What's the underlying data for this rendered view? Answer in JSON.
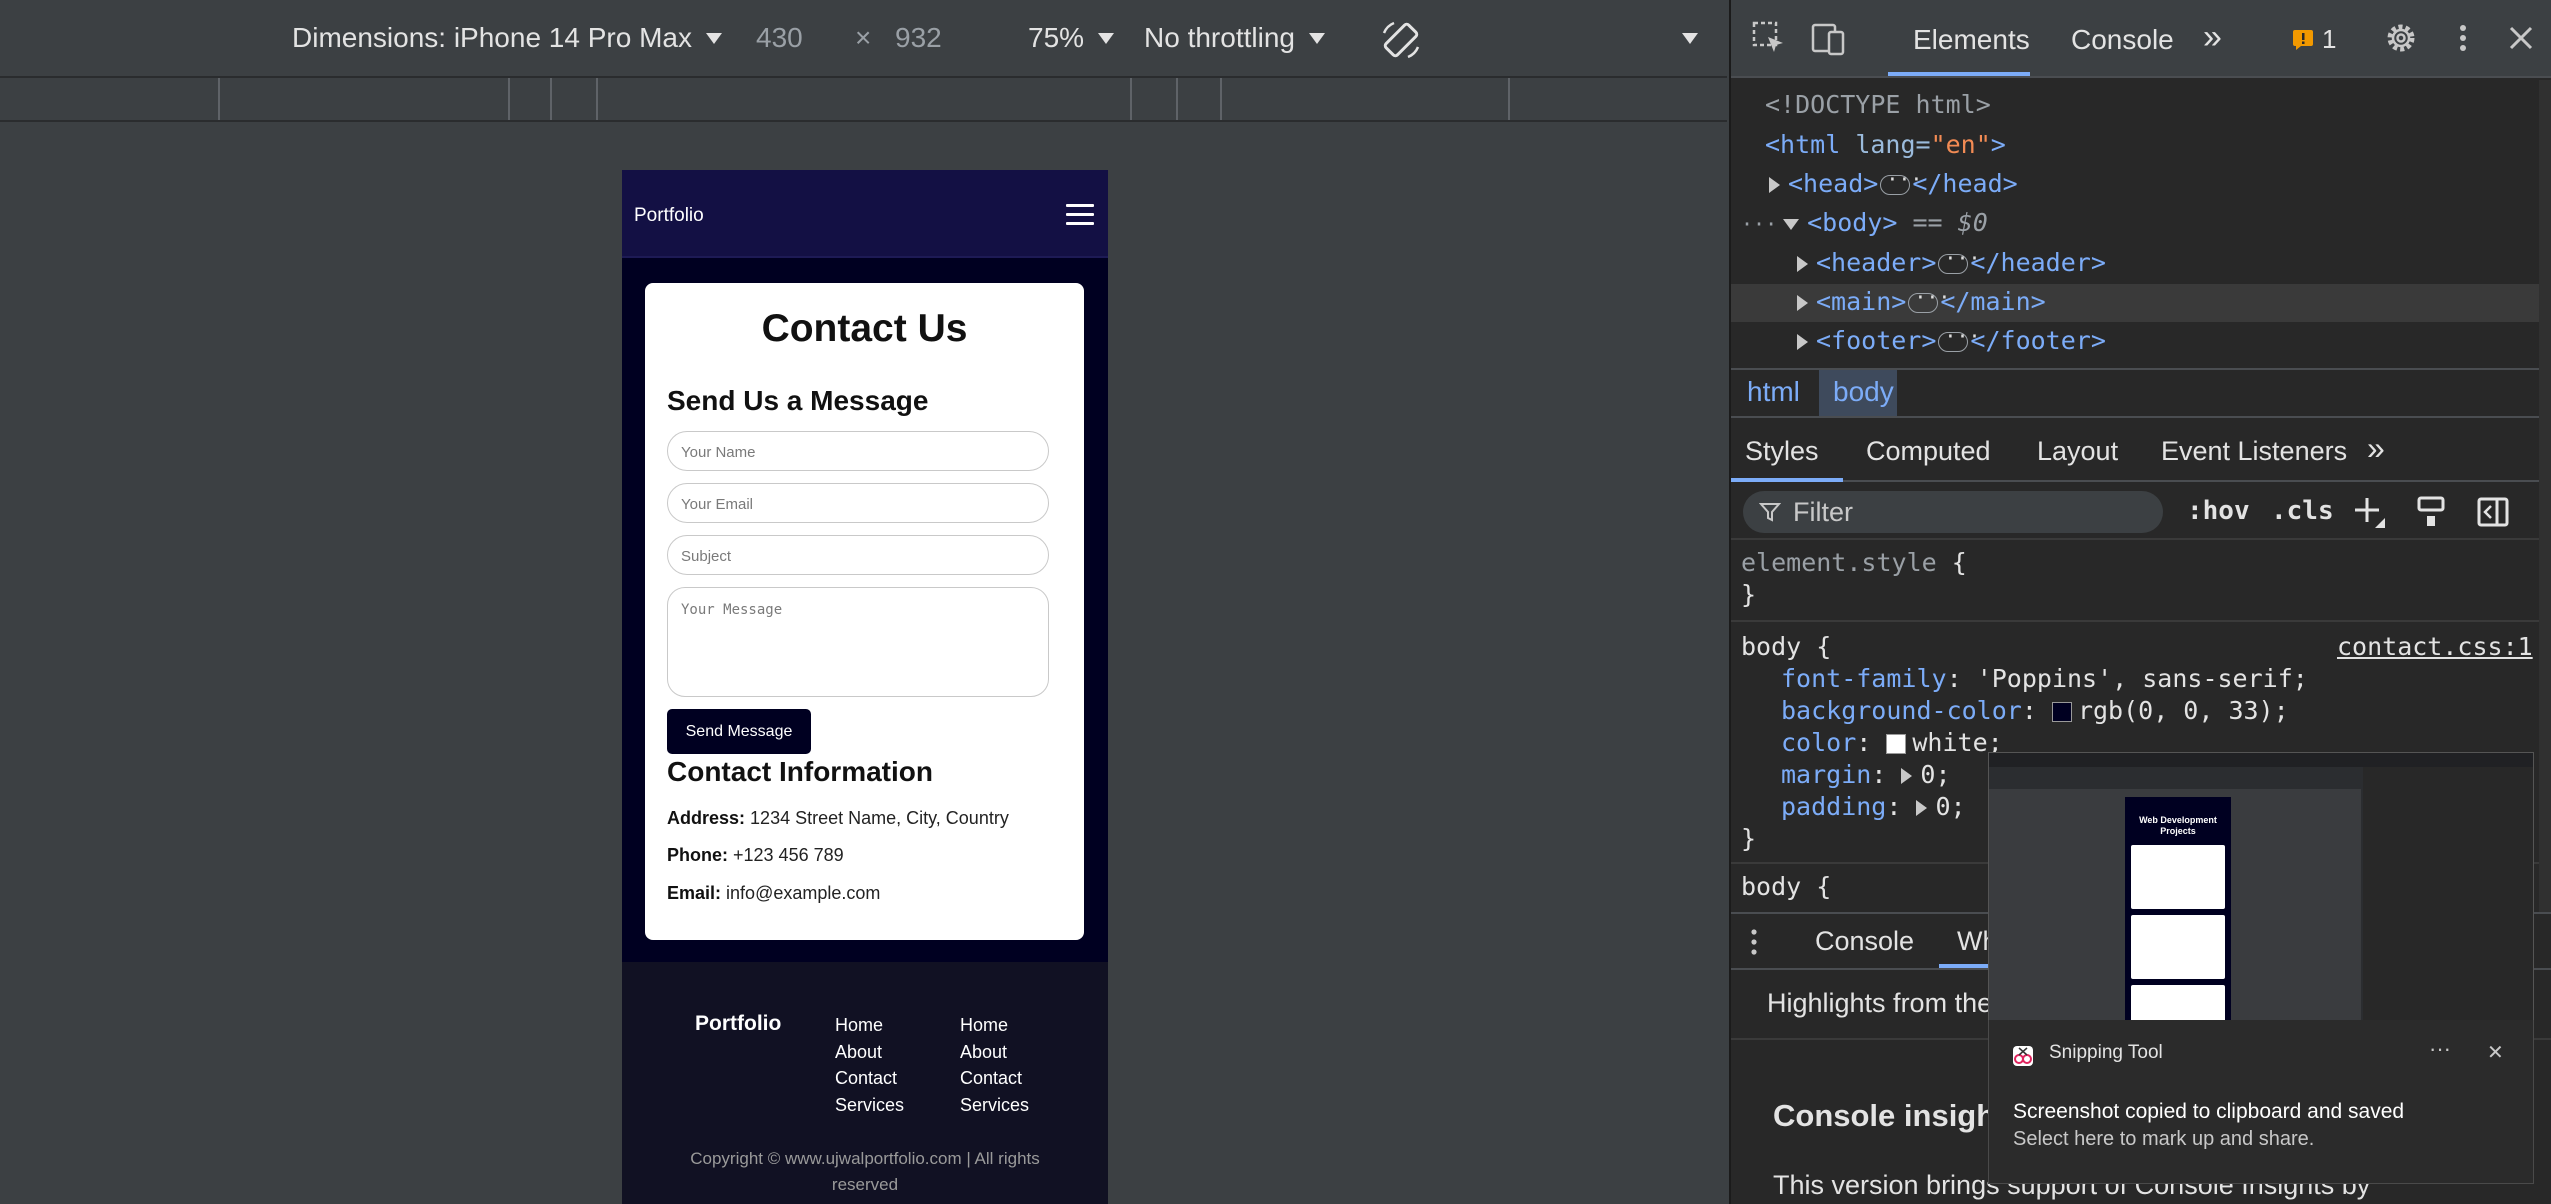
{
  "device_toolbar": {
    "dimensions_label": "Dimensions: iPhone 14 Pro Max",
    "width": "430",
    "times": "×",
    "height": "932",
    "zoom": "75%",
    "throttling": "No throttling"
  },
  "phone": {
    "header": {
      "logo": "Portfolio"
    },
    "contact": {
      "title": "Contact Us",
      "form_title": "Send Us a Message",
      "fields": {
        "name_placeholder": "Your Name",
        "email_placeholder": "Your Email",
        "subject_placeholder": "Subject",
        "message_placeholder": "Your Message"
      },
      "submit_label": "Send Message",
      "info_title": "Contact Information",
      "address_label": "Address:",
      "address_value": "1234 Street Name, City, Country",
      "phone_label": "Phone:",
      "phone_value": "+123 456 789",
      "email_label": "Email:",
      "email_value": "info@example.com"
    },
    "footer": {
      "brand": "Portfolio",
      "col1": [
        "Home",
        "About",
        "Contact",
        "Services"
      ],
      "col2": [
        "Home",
        "About",
        "Contact",
        "Services"
      ],
      "copyright_line1": "Copyright © www.ujwalportfolio.com | All rights",
      "copyright_line2": "reserved"
    }
  },
  "devtools": {
    "tabs": {
      "elements": "Elements",
      "console": "Console",
      "more": "»",
      "issues_count": "1"
    },
    "dom": {
      "doctype": "<!DOCTYPE html>",
      "html_open": "<html",
      "lang_attr": " lang=",
      "lang_val": "\"en\"",
      "html_close": ">",
      "head_open": "<head>",
      "head_close": "</head>",
      "body_open": "<body>",
      "body_marker": "== $0",
      "header_open": "<header>",
      "header_close": "</header>",
      "main_open": "<main>",
      "main_close": "</main>",
      "footer_open": "<footer>",
      "footer_close": "</footer>"
    },
    "breadcrumbs": [
      "html",
      "body"
    ],
    "subtabs": [
      "Styles",
      "Computed",
      "Layout",
      "Event Listeners"
    ],
    "filter_placeholder": "Filter",
    "filter_tools": [
      ":hov",
      ".cls"
    ],
    "css": {
      "element_style": "element.style",
      "brace_open": "{",
      "brace_close": "}",
      "body_selector": "body",
      "source": "contact.css:1",
      "rules": [
        {
          "prop": "font-family",
          "value": "'Poppins', sans-serif;"
        },
        {
          "prop": "background-color",
          "value": "rgb(0, 0, 33);",
          "swatch": "#000021"
        },
        {
          "prop": "color",
          "value": "white;",
          "swatch": "#ffffff"
        },
        {
          "prop": "margin",
          "value": "0;"
        },
        {
          "prop": "padding",
          "value": "0;"
        }
      ],
      "next_selector": "body"
    },
    "drawer": {
      "tabs": [
        "Console",
        "Wh"
      ],
      "highlights": "Highlights from the",
      "insights_title": "Console insight",
      "insights_text": "This version brings support of Console Insights by"
    }
  },
  "snip": {
    "app_name": "Snipping Tool",
    "message": "Screenshot copied to clipboard and saved",
    "sub_message": "Select here to mark up and share.",
    "more": "···",
    "close": "✕",
    "thumb_title_line1": "Web Development",
    "thumb_title_line2": "Projects"
  }
}
